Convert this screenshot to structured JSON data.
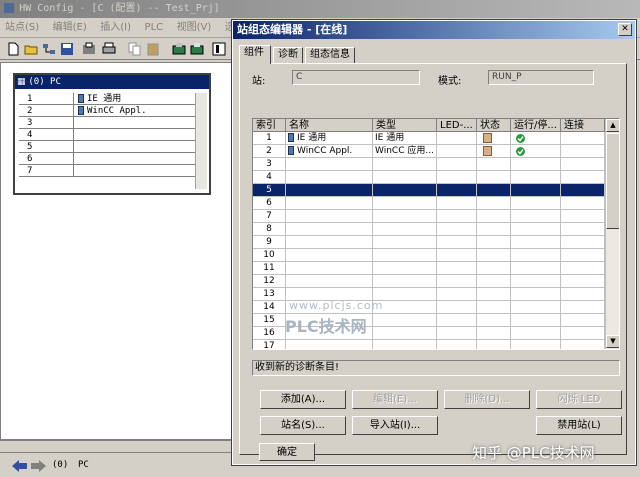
{
  "hw_window": {
    "title": "HW Config - [C (配置) -- Test_Prj]",
    "menu": [
      "站点(S)",
      "编辑(E)",
      "插入(I)",
      "PLC",
      "视图(V)",
      "选项"
    ],
    "rack_title": "(0) PC",
    "rack_rows": [
      {
        "slot": "1",
        "module": "IE 通用"
      },
      {
        "slot": "2",
        "module": "WinCC Appl."
      },
      {
        "slot": "3",
        "module": ""
      },
      {
        "slot": "4",
        "module": ""
      },
      {
        "slot": "5",
        "module": ""
      },
      {
        "slot": "6",
        "module": ""
      },
      {
        "slot": "7",
        "module": ""
      }
    ],
    "status_index": "(0)",
    "status_name": "PC"
  },
  "dialog": {
    "title": "站组态编辑器 - [在线]",
    "close_glyph": "✕",
    "tabs": [
      "组件",
      "诊断",
      "组态信息"
    ],
    "station_label": "站:",
    "station_value": "C",
    "mode_label": "模式:",
    "mode_value": "RUN_P",
    "columns": [
      "索引",
      "名称",
      "类型",
      "LED-...",
      "状态",
      "运行/停...",
      "连接"
    ],
    "rows": [
      {
        "index": "1",
        "name": "IE 通用",
        "type": "IE 通用",
        "status_icon": "status-module-icon",
        "run_icon": "ok-check-icon"
      },
      {
        "index": "2",
        "name": "WinCC Appl.",
        "type": "WinCC 应用...",
        "status_icon": "status-module-icon",
        "run_icon": "ok-check-icon"
      },
      {
        "index": "3"
      },
      {
        "index": "4"
      },
      {
        "index": "5"
      },
      {
        "index": "6"
      },
      {
        "index": "7"
      },
      {
        "index": "8"
      },
      {
        "index": "9"
      },
      {
        "index": "10"
      },
      {
        "index": "11"
      },
      {
        "index": "12"
      },
      {
        "index": "13"
      },
      {
        "index": "14"
      },
      {
        "index": "15"
      },
      {
        "index": "16"
      },
      {
        "index": "17"
      }
    ],
    "selected_row_index": 5,
    "watermark_url": "www.plcjs.com",
    "watermark_text": "PLC技术网",
    "diag_message": "收到新的诊断条目!",
    "buttons": {
      "add": "添加(A)...",
      "edit": "编辑(E)...",
      "delete": "删除(D)...",
      "flash_led": "闪烁 LED",
      "station_name": "站名(S)...",
      "import_station": "导入站(I)...",
      "disable_station": "禁用站(L)",
      "ok": "确定"
    }
  },
  "overlay_watermark": "知乎 @PLC技术网",
  "colors": {
    "selection": "#0a246a",
    "title_active": "#0a246a",
    "ok_green": "#2a9a3a"
  }
}
